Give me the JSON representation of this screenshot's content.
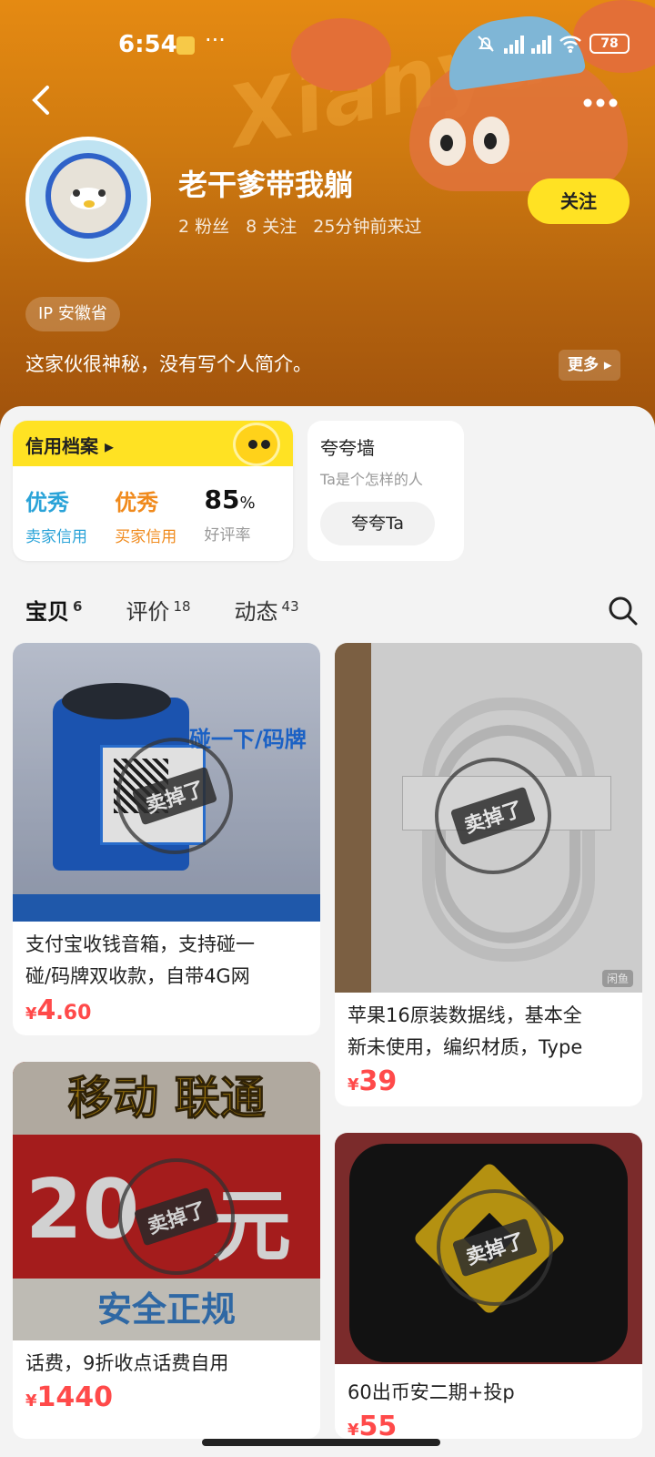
{
  "status_bar": {
    "time": "6:54",
    "dots": "···",
    "battery": "78"
  },
  "profile": {
    "username": "老干爹带我躺",
    "fans": "2 粉丝",
    "following": "8 关注",
    "last_seen": "25分钟前来过",
    "follow_label": "关注",
    "ip": "IP 安徽省",
    "bio": "这家伙很神秘，没有写个人简介。",
    "more_label": "更多"
  },
  "credit": {
    "header": "信用档案",
    "seller_rating": "优秀",
    "seller_label": "卖家信用",
    "buyer_rating": "优秀",
    "buyer_label": "买家信用",
    "positive_rate_num": "85",
    "positive_rate_pct": "%",
    "positive_label": "好评率"
  },
  "praise_wall": {
    "title": "夸夸墙",
    "subtitle": "Ta是个怎样的人",
    "button": "夸夸Ta"
  },
  "tabs": [
    {
      "label": "宝贝",
      "count": "6",
      "active": true
    },
    {
      "label": "评价",
      "count": "18",
      "active": false
    },
    {
      "label": "动态",
      "count": "43",
      "active": false
    }
  ],
  "items": [
    {
      "title_line1": "支付宝收钱音箱，支持碰一",
      "title_line2": "碰/码牌双收款，自带4G网",
      "price_currency": "¥",
      "price_int": "4",
      "price_dec": ".60",
      "sold_label": "卖掉了",
      "image_text": "碰一下/码牌"
    },
    {
      "title_line1": "苹果16原装数据线，基本全",
      "title_line2": "新未使用，编织材质，Type",
      "price_currency": "¥",
      "price_int": "39",
      "price_dec": "",
      "sold_label": "卖掉了",
      "watermark": "闲鱼"
    },
    {
      "title_line1": "话费，9折收点话费自用",
      "title_line2": "",
      "price_currency": "¥",
      "price_int": "1440",
      "price_dec": "",
      "sold_label": "卖掉了",
      "image_top": "移动 联通",
      "image_mid": "20",
      "image_mid2": "元",
      "image_bottom": "安全正规"
    },
    {
      "title_line1": "60出币安二期+投p",
      "title_line2": "",
      "price_currency": "¥",
      "price_int": "55",
      "price_dec": "",
      "sold_label": "卖掉了"
    }
  ],
  "colors": {
    "accent_yellow": "#ffe223",
    "price_red": "#ff4a4a",
    "seller_blue": "#2aa3d8",
    "buyer_orange": "#f08a1c"
  }
}
